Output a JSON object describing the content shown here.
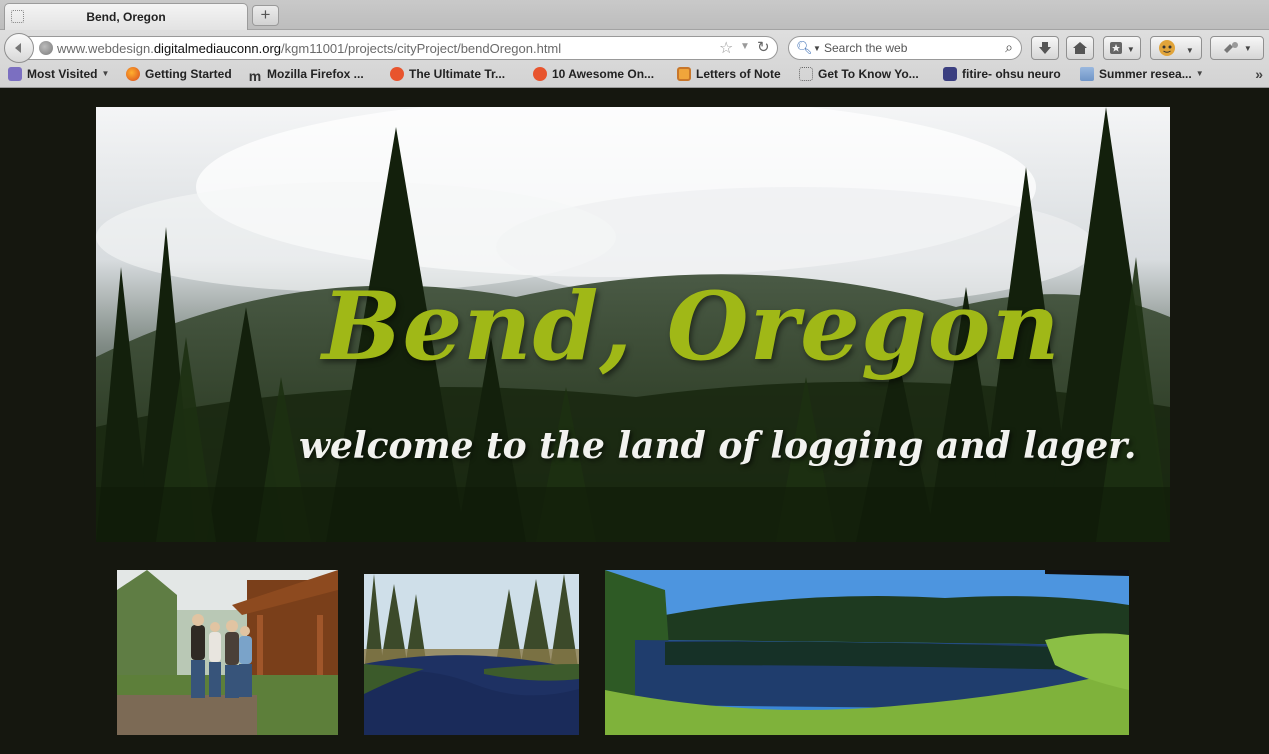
{
  "browser": {
    "tab_title": "Bend, Oregon",
    "new_tab_label": "+",
    "url_prefix": "www.webdesign.",
    "url_domain": "digitalmediauconn.org",
    "url_path": "/kgm11001/projects/cityProject/bendOregon.html",
    "search_placeholder": "Search the web"
  },
  "bookmarks": [
    {
      "label": "Most Visited",
      "icon": "most-visited-icon"
    },
    {
      "label": "Getting Started",
      "icon": "firefox-icon"
    },
    {
      "label": "Mozilla Firefox ...",
      "icon": "mozilla-icon"
    },
    {
      "label": "The Ultimate Tr...",
      "icon": "stumbleupon-icon"
    },
    {
      "label": "10 Awesome On...",
      "icon": "stumbleupon-icon"
    },
    {
      "label": "Letters of Note",
      "icon": "letters-icon"
    },
    {
      "label": "Get To Know Yo...",
      "icon": "blank-page-icon"
    },
    {
      "label": "fitire- ohsu neuro",
      "icon": "document-icon"
    },
    {
      "label": "Summer resea...",
      "icon": "folder-icon"
    }
  ],
  "hero": {
    "title": "Bend, Oregon",
    "subtitle": "welcome to the land of logging and lager."
  },
  "colors": {
    "page_background": "#15170f",
    "title_green": "#a0b817",
    "subtitle_white": "#f2f2ef"
  }
}
